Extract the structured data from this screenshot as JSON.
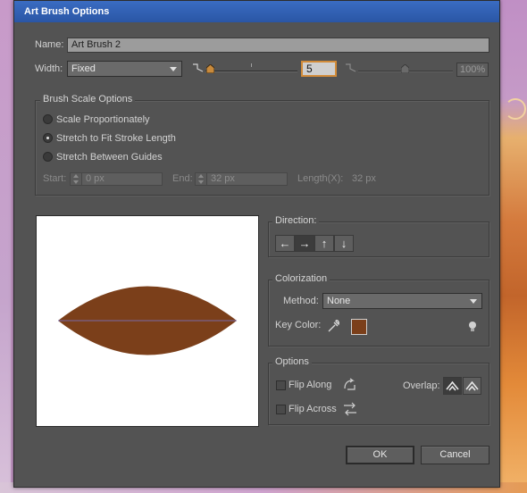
{
  "dialog": {
    "title": "Art Brush Options"
  },
  "name": {
    "label": "Name:",
    "value": "Art Brush 2"
  },
  "width": {
    "label": "Width:",
    "mode": "Fixed",
    "value": "5",
    "variation_percent": "100%"
  },
  "scale_options": {
    "title": "Brush Scale Options",
    "radios": [
      {
        "label": "Scale Proportionately",
        "selected": false
      },
      {
        "label": "Stretch to Fit Stroke Length",
        "selected": true
      },
      {
        "label": "Stretch Between Guides",
        "selected": false
      }
    ],
    "start_label": "Start:",
    "start_value": "0 px",
    "end_label": "End:",
    "end_value": "32 px",
    "length_label": "Length(X):",
    "length_value": "32 px"
  },
  "preview": {
    "fill_color": "#7b3f1a",
    "line_color": "#7a6aa8"
  },
  "direction": {
    "title": "Direction:",
    "buttons": [
      {
        "icon": "arrow-left-icon",
        "glyph": "←",
        "active": false
      },
      {
        "icon": "arrow-right-icon",
        "glyph": "→",
        "active": true
      },
      {
        "icon": "arrow-up-icon",
        "glyph": "↑",
        "active": false
      },
      {
        "icon": "arrow-down-icon",
        "glyph": "↓",
        "active": false
      }
    ]
  },
  "colorization": {
    "title": "Colorization",
    "method_label": "Method:",
    "method_value": "None",
    "key_color_label": "Key Color:",
    "key_color": "#7b3f1a"
  },
  "options": {
    "title": "Options",
    "flip_along": "Flip Along",
    "flip_across": "Flip Across",
    "overlap_label": "Overlap:"
  },
  "buttons": {
    "ok": "OK",
    "cancel": "Cancel"
  },
  "colors": {
    "dialog_bg": "#535353",
    "titlebar": "#2f5fb3",
    "accent_focus": "#d28c3a"
  }
}
